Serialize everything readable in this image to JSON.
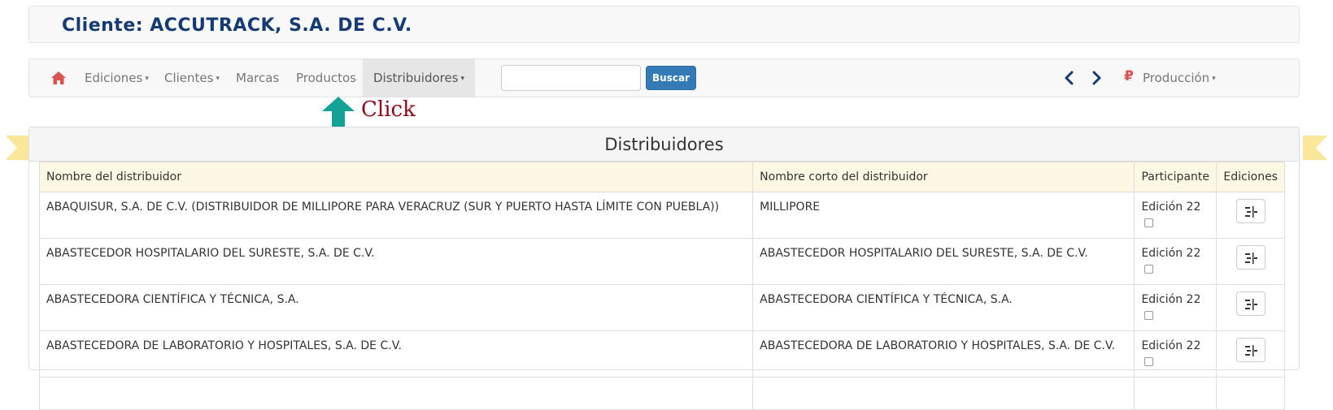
{
  "client": {
    "title": "Cliente: ACCUTRACK, S.A. DE C.V."
  },
  "nav": {
    "home_icon": "home-icon",
    "items": [
      {
        "label": "Ediciones",
        "caret": "▾"
      },
      {
        "label": "Clientes",
        "caret": "▾"
      },
      {
        "label": "Marcas"
      },
      {
        "label": "Productos"
      },
      {
        "label": "Distribuidores",
        "caret": "▾",
        "active": true
      }
    ],
    "search": {
      "value": "",
      "placeholder": "",
      "button_label": "Buscar"
    },
    "prev_icon": "chevron-left-icon",
    "next_icon": "chevron-right-icon",
    "environment": {
      "icon": "₽",
      "label": "Producción",
      "caret": "▾"
    }
  },
  "annotation": {
    "label": "Click",
    "arrow_color": "#14a296"
  },
  "panel": {
    "title": "Distribuidores",
    "columns": [
      "Nombre del distribuidor",
      "Nombre corto del distribuidor",
      "Participante",
      "Ediciones"
    ],
    "rows": [
      {
        "name": "ABAQUISUR, S.A. DE C.V. (DISTRIBUIDOR DE MILLIPORE PARA VERACRUZ (SUR Y PUERTO HASTA LÍMITE CON PUEBLA))",
        "short": "MILLIPORE",
        "participant": "Edición 22"
      },
      {
        "name": "ABASTECEDOR HOSPITALARIO DEL SURESTE, S.A. DE C.V.",
        "short": "ABASTECEDOR HOSPITALARIO DEL SURESTE, S.A. DE C.V.",
        "participant": "Edición 22"
      },
      {
        "name": "ABASTECEDORA CIENTÍFICA Y TÉCNICA, S.A.",
        "short": "ABASTECEDORA CIENTÍFICA Y TÉCNICA, S.A.",
        "participant": "Edición 22"
      },
      {
        "name": "ABASTECEDORA DE LABORATORIO Y HOSPITALES, S.A. DE C.V.",
        "short": "ABASTECEDORA DE LABORATORIO Y HOSPITALES, S.A. DE C.V.",
        "participant": "Edición 22"
      },
      {
        "name": "",
        "short": "",
        "participant": ""
      }
    ]
  },
  "colors": {
    "brand": "#163b73",
    "primary": "#337ab7",
    "accent_red": "#d9534f",
    "header_row": "#fcf8e3",
    "ribbon": "#fbe79a"
  }
}
